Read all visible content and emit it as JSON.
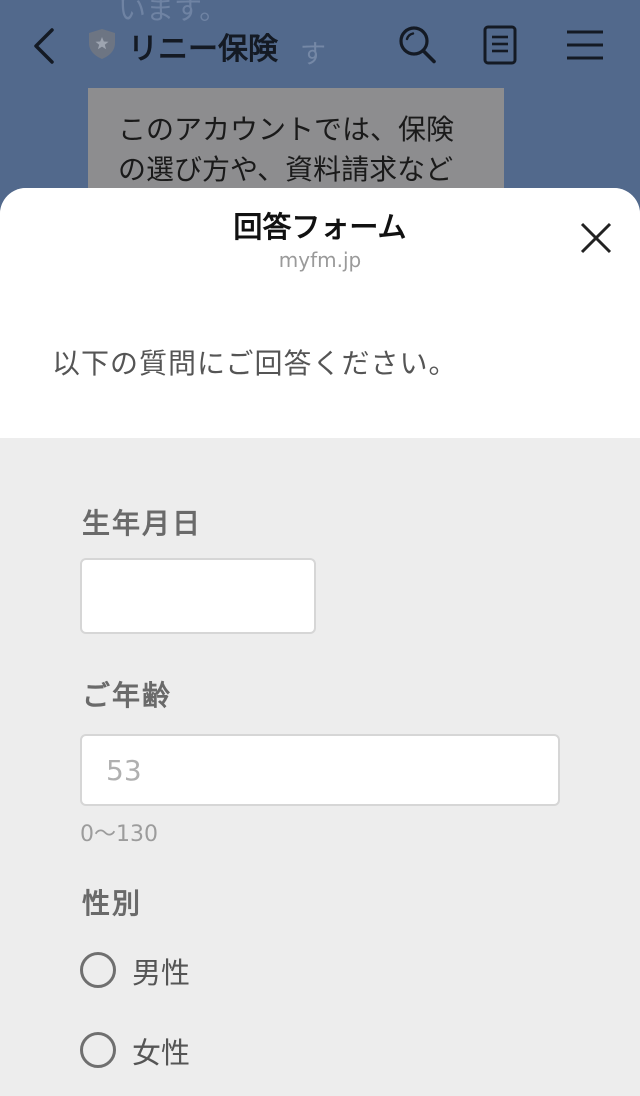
{
  "chat": {
    "title": "リニー保険",
    "ghost_line1": "います。",
    "ghost_line2": "す",
    "bubble_lines": [
      "このアカウントでは、保険",
      "の選び方や、資料請求など"
    ]
  },
  "header_icons": {
    "back": "chevron-left-icon",
    "verified": "shield-icon",
    "search": "search-icon",
    "notes": "notes-icon",
    "menu": "hamburger-menu-icon"
  },
  "sheet": {
    "title": "回答フォーム",
    "url": "myfm.jp",
    "close_icon": "close-icon"
  },
  "form": {
    "intro": "以下の質問にご回答ください。",
    "birthdate": {
      "label": "生年月日",
      "value": "",
      "placeholder": ""
    },
    "age": {
      "label": "ご年齢",
      "value": "",
      "placeholder": "53",
      "hint": "0〜130"
    },
    "gender": {
      "label": "性別",
      "options": [
        {
          "label": "男性",
          "selected": false
        },
        {
          "label": "女性",
          "selected": false
        }
      ]
    }
  },
  "colors": {
    "chat_background": "#52698c",
    "bubble": "#8d8d8f",
    "sheet_background": "#ededed",
    "input_border": "#d6d6d6"
  }
}
